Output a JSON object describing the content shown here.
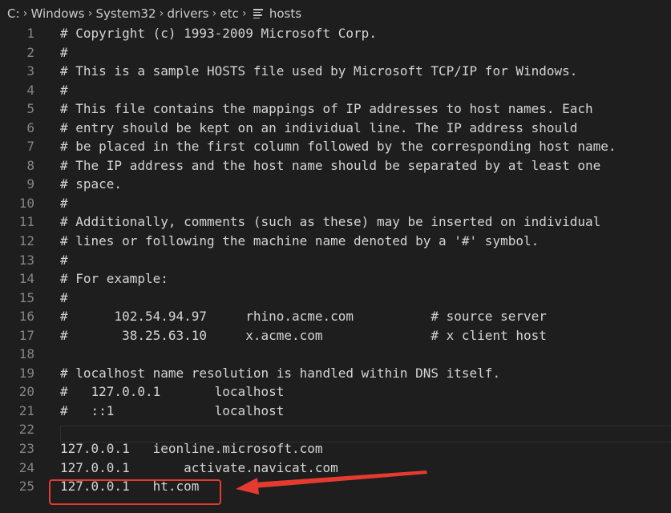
{
  "breadcrumb": {
    "items": [
      "C:",
      "Windows",
      "System32",
      "drivers",
      "etc"
    ],
    "file": "hosts"
  },
  "editor": {
    "lines": [
      {
        "num": "1",
        "text": "# Copyright (c) 1993-2009 Microsoft Corp."
      },
      {
        "num": "2",
        "text": "#"
      },
      {
        "num": "3",
        "text": "# This is a sample HOSTS file used by Microsoft TCP/IP for Windows."
      },
      {
        "num": "4",
        "text": "#"
      },
      {
        "num": "5",
        "text": "# This file contains the mappings of IP addresses to host names. Each"
      },
      {
        "num": "6",
        "text": "# entry should be kept on an individual line. The IP address should"
      },
      {
        "num": "7",
        "text": "# be placed in the first column followed by the corresponding host name."
      },
      {
        "num": "8",
        "text": "# The IP address and the host name should be separated by at least one"
      },
      {
        "num": "9",
        "text": "# space."
      },
      {
        "num": "10",
        "text": "#"
      },
      {
        "num": "11",
        "text": "# Additionally, comments (such as these) may be inserted on individual"
      },
      {
        "num": "12",
        "text": "# lines or following the machine name denoted by a '#' symbol."
      },
      {
        "num": "13",
        "text": "#"
      },
      {
        "num": "14",
        "text": "# For example:"
      },
      {
        "num": "15",
        "text": "#"
      },
      {
        "num": "16",
        "text": "#      102.54.94.97     rhino.acme.com          # source server"
      },
      {
        "num": "17",
        "text": "#       38.25.63.10     x.acme.com              # x client host"
      },
      {
        "num": "18",
        "text": ""
      },
      {
        "num": "19",
        "text": "# localhost name resolution is handled within DNS itself."
      },
      {
        "num": "20",
        "text": "#   127.0.0.1       localhost"
      },
      {
        "num": "21",
        "text": "#   ::1             localhost"
      },
      {
        "num": "22",
        "text": ""
      },
      {
        "num": "23",
        "text": "127.0.0.1   ieonline.microsoft.com"
      },
      {
        "num": "24",
        "text": "127.0.0.1       activate.navicat.com"
      },
      {
        "num": "25",
        "text": "127.0.0.1   ht.com"
      }
    ]
  },
  "annotation": {
    "color": "#e53a2f"
  }
}
